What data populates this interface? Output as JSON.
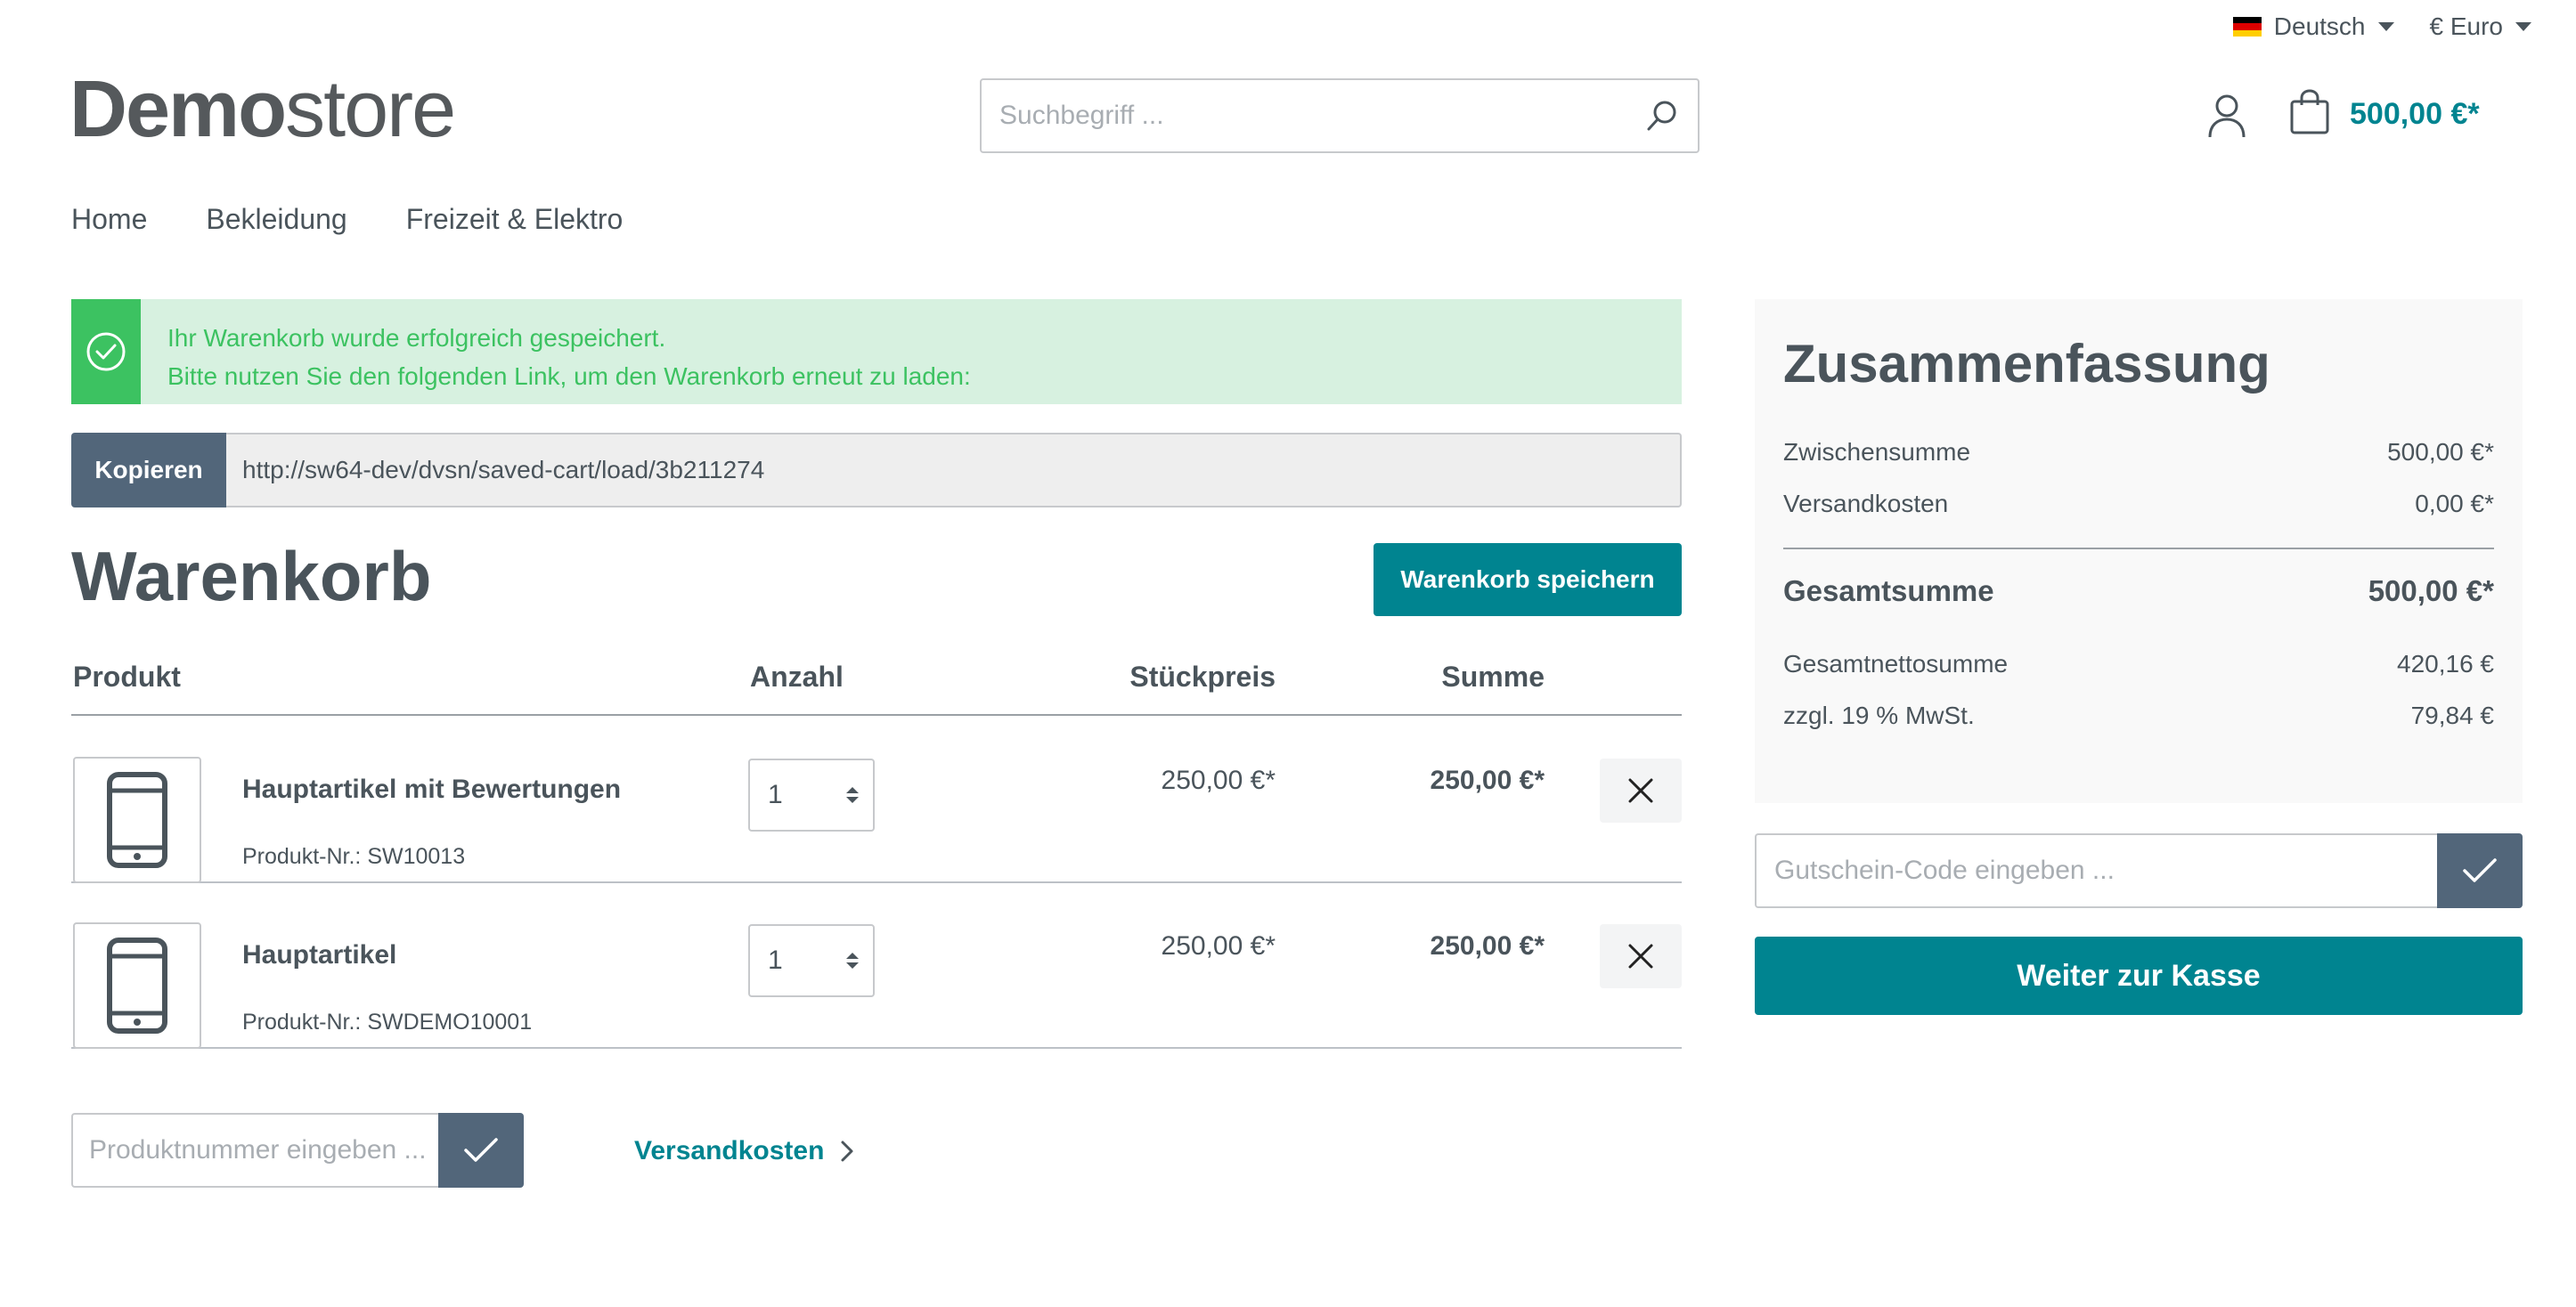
{
  "topbar": {
    "language": "Deutsch",
    "currency": "€ Euro",
    "flag_colors": [
      "#000000",
      "#dd0000",
      "#ffce00"
    ]
  },
  "header": {
    "logo_bold": "Demo",
    "logo_light": "store",
    "search_placeholder": "Suchbegriff ...",
    "cart_amount": "500,00 €*"
  },
  "nav": {
    "items": [
      "Home",
      "Bekleidung",
      "Freizeit & Elektro"
    ]
  },
  "alert": {
    "line1": "Ihr Warenkorb wurde erfolgreich gespeichert.",
    "line2": "Bitte nutzen Sie den folgenden Link, um den Warenkorb erneut zu laden:"
  },
  "copy": {
    "button_label": "Kopieren",
    "link": "http://sw64-dev/dvsn/saved-cart/load/3b211274"
  },
  "cart": {
    "title": "Warenkorb",
    "save_label": "Warenkorb speichern",
    "columns": {
      "product": "Produkt",
      "quantity": "Anzahl",
      "unit_price": "Stückpreis",
      "total": "Summe"
    },
    "items": [
      {
        "name": "Hauptartikel mit Bewertungen",
        "number": "Produkt-Nr.: SW10013",
        "quantity": "1",
        "unit_price": "250,00 €*",
        "total": "250,00 €*"
      },
      {
        "name": "Hauptartikel",
        "number": "Produkt-Nr.: SWDEMO10001",
        "quantity": "1",
        "unit_price": "250,00 €*",
        "total": "250,00 €*"
      }
    ],
    "add_product_placeholder": "Produktnummer eingeben ...",
    "shipping_link": "Versandkosten"
  },
  "summary": {
    "title": "Zusammenfassung",
    "subtotal_label": "Zwischensumme",
    "subtotal_value": "500,00 €*",
    "shipping_label": "Versandkosten",
    "shipping_value": "0,00 €*",
    "total_label": "Gesamtsumme",
    "total_value": "500,00 €*",
    "net_label": "Gesamtnettosumme",
    "net_value": "420,16 €",
    "vat_label": "zzgl. 19 % MwSt.",
    "vat_value": "79,84 €",
    "voucher_placeholder": "Gutschein-Code eingeben ...",
    "checkout_label": "Weiter zur Kasse"
  },
  "colors": {
    "primary": "#008490",
    "secondary": "#52667a",
    "success": "#3cc261",
    "success_bg": "#d7f1e0"
  }
}
